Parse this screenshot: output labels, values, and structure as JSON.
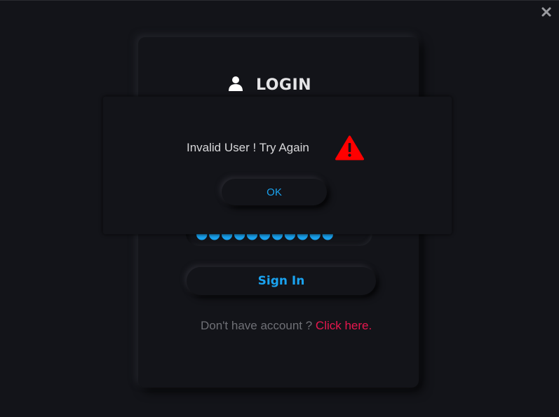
{
  "window": {
    "close_icon": "close-icon"
  },
  "login": {
    "title": "LOGIN",
    "user_icon": "user-icon",
    "password_masked": "●●●●●●●●●●●",
    "signin_label": "Sign In",
    "signup_question": "Don't have account ? ",
    "signup_link": "Click here."
  },
  "dialog": {
    "message": "Invalid User ! Try Again",
    "ok_label": "OK",
    "warning_icon": "warning-icon"
  },
  "colors": {
    "background": "#131419",
    "accent_blue": "#1aa3f0",
    "link_red": "#e8174f",
    "warning_red": "#ff0000"
  }
}
